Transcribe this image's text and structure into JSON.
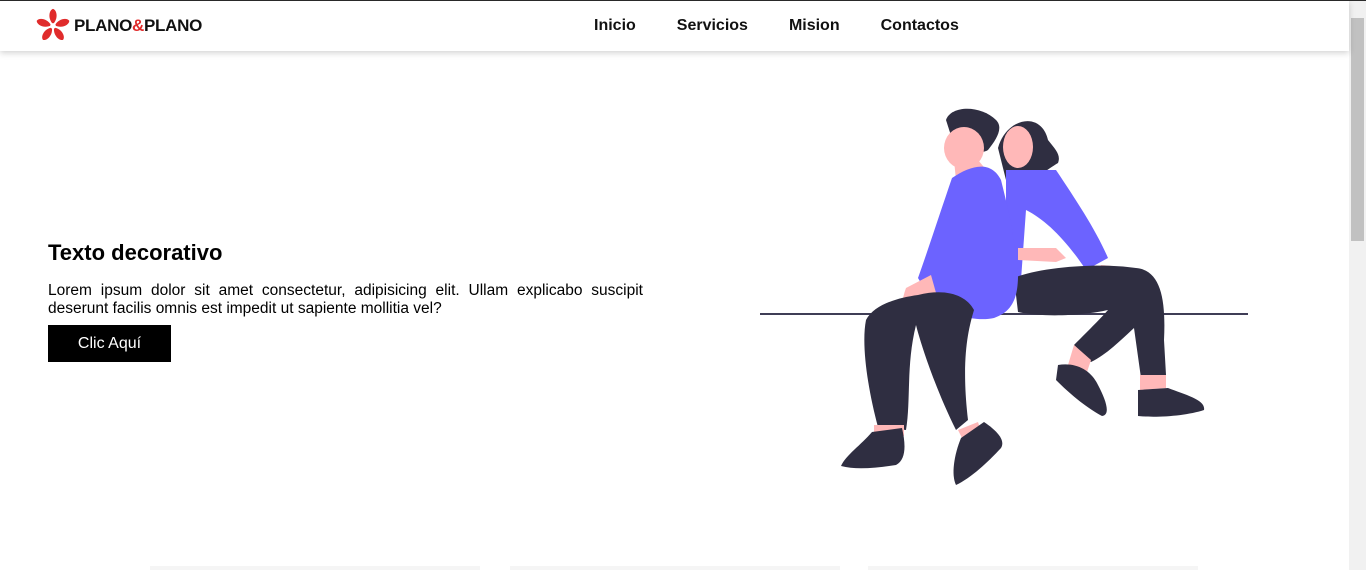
{
  "brand": {
    "name_part1": "PLANO",
    "amp": "&",
    "name_part2": "PLANO",
    "accent_color": "#e02b2b"
  },
  "nav": {
    "items": [
      "Inicio",
      "Servicios",
      "Mision",
      "Contactos"
    ]
  },
  "hero": {
    "title": "Texto decorativo",
    "description": "Lorem ipsum dolor sit amet consectetur, adipisicing elit. Ullam explicabo suscipit deserunt facilis omnis est impedit ut sapiente mollitia vel?",
    "button_label": "Clic Aquí"
  },
  "illustration": {
    "name": "couple-sitting-illustration",
    "accent_color": "#6c63ff",
    "dark_color": "#2f2e41",
    "skin_color": "#ffb8b8"
  }
}
